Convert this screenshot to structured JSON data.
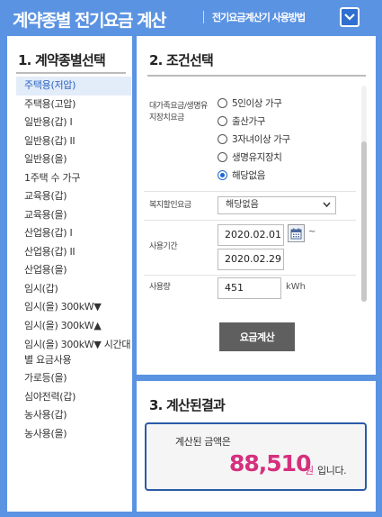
{
  "header": {
    "title": "계약종별 전기요금 계산",
    "guide_link": "전기요금계산기 사용방법",
    "dropdown_icon": "chevron-down-icon"
  },
  "contract_panel": {
    "title": "1. 계약종별선택",
    "items": [
      {
        "label": "주택용(저압)",
        "selected": true
      },
      {
        "label": "주택용(고압)"
      },
      {
        "label": "일반용(갑) I"
      },
      {
        "label": "일반용(갑) II"
      },
      {
        "label": "일반용(을)"
      },
      {
        "label": "1주택 수 가구"
      },
      {
        "label": "교육용(갑)"
      },
      {
        "label": "교육용(을)"
      },
      {
        "label": "산업용(갑) I"
      },
      {
        "label": "산업용(갑) II"
      },
      {
        "label": "산업용(을)"
      },
      {
        "label": "임시(갑)"
      },
      {
        "label": "임시(을) 300kW▼"
      },
      {
        "label": "임시(을) 300kW▲"
      },
      {
        "label": "임시(을) 300kW▼ 시간대별 요금사용"
      },
      {
        "label": "가로등(을)"
      },
      {
        "label": "심야전력(갑)"
      },
      {
        "label": "농사용(갑)"
      },
      {
        "label": "농사용(을)"
      }
    ]
  },
  "conditions_panel": {
    "title": "2. 조건선택",
    "discount_label": "대가족요금/생명유지장치요금",
    "discount_options": [
      {
        "label": "5인이상 가구",
        "checked": false
      },
      {
        "label": "출산가구",
        "checked": false
      },
      {
        "label": "3자녀이상 가구",
        "checked": false
      },
      {
        "label": "생명유지장치",
        "checked": false
      },
      {
        "label": "해당없음",
        "checked": true
      }
    ],
    "welfare_label": "복지할인요금",
    "welfare_value": "해당없음",
    "period_label": "사용기간",
    "period_start": "2020.02.01",
    "period_end": "2020.02.29",
    "period_tilde": "~",
    "usage_label": "사용량",
    "usage_value": "451",
    "usage_unit": "kWh",
    "calc_button": "요금계산"
  },
  "result_panel": {
    "title": "3. 계산된결과",
    "label": "계산된 금액은",
    "amount": "88,510",
    "currency": "원",
    "suffix": "입니다."
  },
  "colors": {
    "background": "#5b93e3",
    "accent_blue": "#2b5aa8",
    "amount_pink": "#d52f7d",
    "button_gray": "#5f5f5f"
  }
}
